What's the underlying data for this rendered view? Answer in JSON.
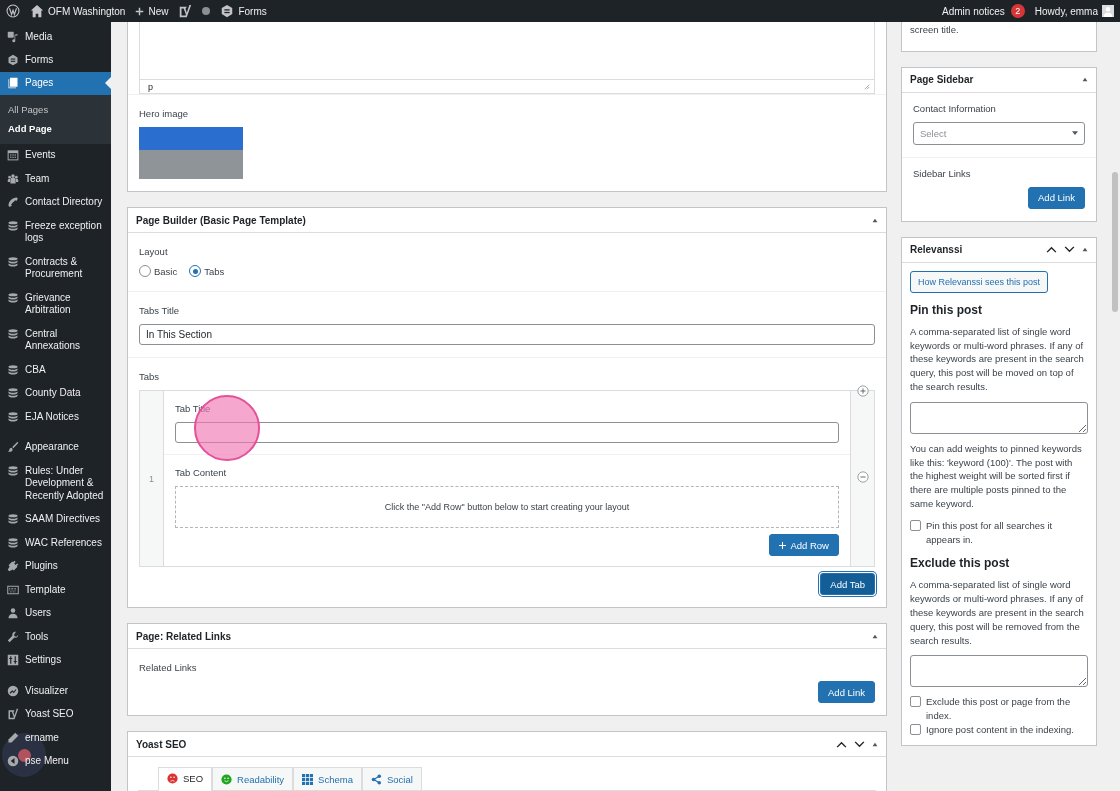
{
  "admin_bar": {
    "site": "OFM Washington",
    "new_label": "New",
    "forms_label": "Forms",
    "notices_label": "Admin notices",
    "notice_count": "2",
    "greeting": "Howdy, emma"
  },
  "menu_groups": [
    {
      "items": [
        {
          "label": "Media",
          "kind": "media",
          "selected": false
        },
        {
          "label": "Forms",
          "kind": "forms",
          "selected": false
        },
        {
          "label": "Pages",
          "kind": "pages",
          "selected": true,
          "children": [
            {
              "label": "All Pages",
              "selected": false
            },
            {
              "label": "Add Page",
              "selected": true
            }
          ]
        },
        {
          "label": "Events",
          "kind": "calendar",
          "selected": false
        },
        {
          "label": "Team",
          "kind": "team",
          "selected": false
        },
        {
          "label": "Contact Directory",
          "kind": "phone",
          "selected": false
        },
        {
          "label": "Freeze exception logs",
          "kind": "database",
          "selected": false
        },
        {
          "label": "Contracts & Procurement",
          "kind": "database",
          "selected": false
        },
        {
          "label": "Grievance Arbitration",
          "kind": "database",
          "selected": false
        },
        {
          "label": "Central Annexations",
          "kind": "database",
          "selected": false
        },
        {
          "label": "CBA",
          "kind": "database",
          "selected": false
        },
        {
          "label": "County Data",
          "kind": "database",
          "selected": false
        },
        {
          "label": "EJA Notices",
          "kind": "database",
          "selected": false
        }
      ]
    },
    {
      "items": [
        {
          "label": "Appearance",
          "kind": "brush",
          "selected": false
        },
        {
          "label": "Rules: Under Development & Recently Adopted",
          "kind": "database",
          "selected": false
        },
        {
          "label": "SAAM Directives",
          "kind": "database",
          "selected": false
        },
        {
          "label": "WAC References",
          "kind": "database",
          "selected": false
        },
        {
          "label": "Plugins",
          "kind": "plug",
          "selected": false
        },
        {
          "label": "Template",
          "kind": "template",
          "selected": false
        },
        {
          "label": "Users",
          "kind": "user",
          "selected": false
        },
        {
          "label": "Tools",
          "kind": "wrench",
          "selected": false
        },
        {
          "label": "Settings",
          "kind": "settings",
          "selected": false
        }
      ]
    },
    {
      "items": [
        {
          "label": "Visualizer",
          "kind": "chart",
          "selected": false
        },
        {
          "label": "Yoast SEO",
          "kind": "yoast",
          "selected": false
        },
        {
          "label": "ername",
          "kind": "pencil",
          "selected": false
        },
        {
          "label": "pse Menu",
          "kind": "collapse",
          "selected": false
        }
      ]
    }
  ],
  "editor": {
    "status_path": "p",
    "hero_label": "Hero image"
  },
  "page_builder": {
    "title": "Page Builder (Basic Page Template)",
    "layout_label": "Layout",
    "layout_options": [
      {
        "label": "Basic",
        "selected": false
      },
      {
        "label": "Tabs",
        "selected": true
      }
    ],
    "tabs_title_label": "Tabs Title",
    "tabs_title_value": "In This Section",
    "tabs_label": "Tabs",
    "tabs": [
      {
        "number": "1",
        "title_label": "Tab Title",
        "content_label": "Tab Content",
        "empty_hint": "Click the \"Add Row\" button below to start creating your layout",
        "add_row": "Add Row"
      }
    ],
    "add_tab": "Add Tab"
  },
  "related_links": {
    "title": "Page: Related Links",
    "label": "Related Links",
    "button": "Add Link"
  },
  "yoast": {
    "title": "Yoast SEO",
    "tabs": [
      {
        "label": "SEO",
        "kind": "score",
        "color": "#dc3232",
        "selected": true
      },
      {
        "label": "Readability",
        "kind": "score",
        "color": "#1fa51f",
        "selected": false
      },
      {
        "label": "Schema",
        "kind": "schema",
        "selected": false
      },
      {
        "label": "Social",
        "kind": "social",
        "selected": false
      }
    ]
  },
  "side_top": {
    "text": "screen title."
  },
  "page_sidebar": {
    "title": "Page Sidebar",
    "contact_label": "Contact Information",
    "select_placeholder": "Select",
    "links_label": "Sidebar Links",
    "button": "Add Link"
  },
  "relevanssi": {
    "title": "Relevanssi",
    "view_button": "How Relevanssi sees this post",
    "pin_heading": "Pin this post",
    "pin_text": "A comma-separated list of single word keywords or multi-word phrases. If any of these keywords are present in the search query, this post will be moved on top of the search results.",
    "weights_text": "You can add weights to pinned keywords like this: 'keyword (100)'. The post with the highest weight will be sorted first if there are multiple posts pinned to the same keyword.",
    "pin_all": {
      "label": "Pin this post for all searches it appears in.",
      "checked": false
    },
    "exclude_heading": "Exclude this post",
    "exclude_text": "A comma-separated list of single word keywords or multi-word phrases. If any of these keywords are present in the search query, this post will be removed from the search results.",
    "options": [
      {
        "label": "Exclude this post or page from the index.",
        "checked": false
      },
      {
        "label": "Ignore post content in the indexing.",
        "checked": false
      }
    ]
  }
}
